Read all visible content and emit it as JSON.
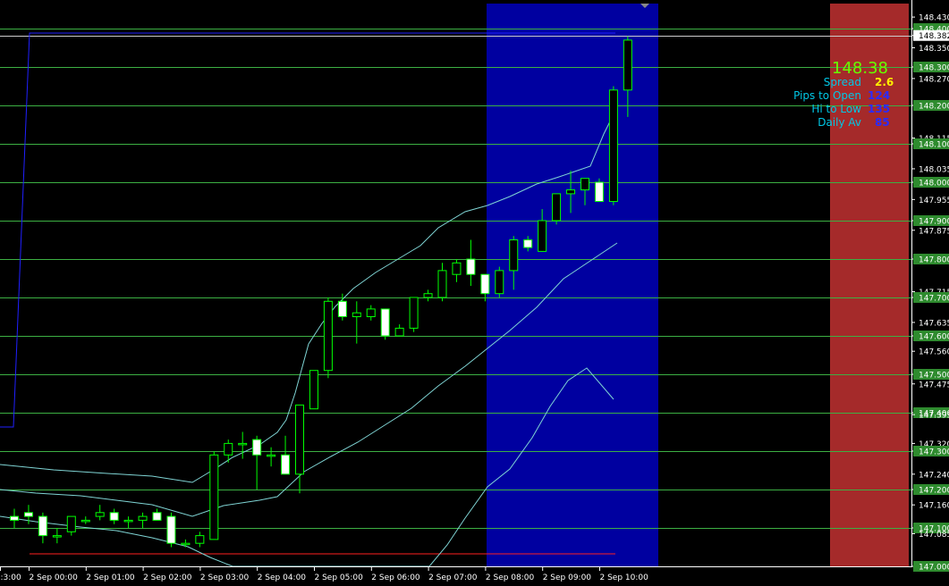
{
  "colors": {
    "background": "#000000",
    "bull_candle": "#000000",
    "bear_candle": "#ffffff",
    "candle_outline": "#00ff00",
    "grid_line": "#3cb043",
    "price_label_bg": "#2e8b2e",
    "current_price_label_bg": "#ffffff",
    "session_band": "#0000a0",
    "right_zone": "#a52a2a",
    "band_line": "#7fd4d4",
    "blue_line": "#2020ff",
    "red_line": "#ff2020",
    "info_green": "#66ff00",
    "info_cyan": "#00c8e6",
    "info_yellow": "#ffee00",
    "info_blue": "#2a2aff"
  },
  "info": {
    "price": "148.38",
    "rows": [
      {
        "label": "Spread",
        "value": "2.6",
        "color": "#ffee00"
      },
      {
        "label": "Pips to Open",
        "value": "124",
        "color": "#2a2aff"
      },
      {
        "label": "Hi to Low",
        "value": "135",
        "color": "#2a2aff"
      },
      {
        "label": "Daily Av",
        "value": "85",
        "color": "#2a2aff"
      }
    ]
  },
  "chart_data": {
    "type": "candlestick",
    "y_axis_labels": [
      "148.430",
      "148.400",
      "148.382",
      "148.350",
      "148.300",
      "148.270",
      "148.200",
      "148.115",
      "148.100",
      "148.035",
      "148.000",
      "147.955",
      "147.900",
      "147.875",
      "147.800",
      "147.715",
      "147.700",
      "147.635",
      "147.600",
      "147.560",
      "147.500",
      "147.475",
      "147.400",
      "147.395",
      "147.320",
      "147.300",
      "147.240",
      "147.200",
      "147.160",
      "147.100",
      "147.085",
      "147.000"
    ],
    "level_lines": [
      148.4,
      148.3,
      148.2,
      148.1,
      148.0,
      147.9,
      147.8,
      147.7,
      147.6,
      147.5,
      147.4,
      147.3,
      147.2,
      147.1,
      147.0
    ],
    "current_price": 148.382,
    "x_axis_labels": [
      ":3:00",
      "2 Sep 00:00",
      "2 Sep 01:00",
      "2 Sep 02:00",
      "2 Sep 03:00",
      "2 Sep 04:00",
      "2 Sep 05:00",
      "2 Sep 06:00",
      "2 Sep 07:00",
      "2 Sep 08:00",
      "2 Sep 09:00",
      "2 Sep 10:00"
    ],
    "candles": [
      {
        "o": 147.13,
        "h": 147.15,
        "l": 147.1,
        "c": 147.12
      },
      {
        "o": 147.14,
        "h": 147.16,
        "l": 147.11,
        "c": 147.13
      },
      {
        "o": 147.13,
        "h": 147.14,
        "l": 147.06,
        "c": 147.08
      },
      {
        "o": 147.08,
        "h": 147.1,
        "l": 147.06,
        "c": 147.08
      },
      {
        "o": 147.09,
        "h": 147.13,
        "l": 147.08,
        "c": 147.13
      },
      {
        "o": 147.12,
        "h": 147.13,
        "l": 147.11,
        "c": 147.12
      },
      {
        "o": 147.13,
        "h": 147.16,
        "l": 147.12,
        "c": 147.14
      },
      {
        "o": 147.14,
        "h": 147.15,
        "l": 147.11,
        "c": 147.12
      },
      {
        "o": 147.12,
        "h": 147.13,
        "l": 147.1,
        "c": 147.12
      },
      {
        "o": 147.12,
        "h": 147.14,
        "l": 147.1,
        "c": 147.13
      },
      {
        "o": 147.14,
        "h": 147.15,
        "l": 147.12,
        "c": 147.12
      },
      {
        "o": 147.13,
        "h": 147.14,
        "l": 147.05,
        "c": 147.06
      },
      {
        "o": 147.06,
        "h": 147.07,
        "l": 147.05,
        "c": 147.06
      },
      {
        "o": 147.06,
        "h": 147.09,
        "l": 147.05,
        "c": 147.08
      },
      {
        "o": 147.07,
        "h": 147.3,
        "l": 147.07,
        "c": 147.29
      },
      {
        "o": 147.29,
        "h": 147.33,
        "l": 147.27,
        "c": 147.32
      },
      {
        "o": 147.32,
        "h": 147.35,
        "l": 147.28,
        "c": 147.32
      },
      {
        "o": 147.33,
        "h": 147.34,
        "l": 147.2,
        "c": 147.29
      },
      {
        "o": 147.29,
        "h": 147.31,
        "l": 147.26,
        "c": 147.29
      },
      {
        "o": 147.29,
        "h": 147.34,
        "l": 147.24,
        "c": 147.24
      },
      {
        "o": 147.24,
        "h": 147.4,
        "l": 147.19,
        "c": 147.42
      },
      {
        "o": 147.41,
        "h": 147.51,
        "l": 147.41,
        "c": 147.51
      },
      {
        "o": 147.51,
        "h": 147.7,
        "l": 147.49,
        "c": 147.69
      },
      {
        "o": 147.69,
        "h": 147.71,
        "l": 147.64,
        "c": 147.65
      },
      {
        "o": 147.65,
        "h": 147.69,
        "l": 147.58,
        "c": 147.66
      },
      {
        "o": 147.65,
        "h": 147.68,
        "l": 147.64,
        "c": 147.67
      },
      {
        "o": 147.67,
        "h": 147.67,
        "l": 147.59,
        "c": 147.6
      },
      {
        "o": 147.6,
        "h": 147.63,
        "l": 147.6,
        "c": 147.62
      },
      {
        "o": 147.62,
        "h": 147.7,
        "l": 147.61,
        "c": 147.7
      },
      {
        "o": 147.7,
        "h": 147.72,
        "l": 147.69,
        "c": 147.71
      },
      {
        "o": 147.7,
        "h": 147.79,
        "l": 147.69,
        "c": 147.77
      },
      {
        "o": 147.76,
        "h": 147.8,
        "l": 147.74,
        "c": 147.79
      },
      {
        "o": 147.8,
        "h": 147.85,
        "l": 147.73,
        "c": 147.76
      },
      {
        "o": 147.76,
        "h": 147.76,
        "l": 147.69,
        "c": 147.71
      },
      {
        "o": 147.71,
        "h": 147.78,
        "l": 147.7,
        "c": 147.77
      },
      {
        "o": 147.77,
        "h": 147.86,
        "l": 147.72,
        "c": 147.85
      },
      {
        "o": 147.85,
        "h": 147.86,
        "l": 147.82,
        "c": 147.83
      },
      {
        "o": 147.82,
        "h": 147.93,
        "l": 147.82,
        "c": 147.9
      },
      {
        "o": 147.9,
        "h": 147.96,
        "l": 147.89,
        "c": 147.97
      },
      {
        "o": 147.97,
        "h": 148.03,
        "l": 147.92,
        "c": 147.98
      },
      {
        "o": 147.98,
        "h": 148.0,
        "l": 147.94,
        "c": 148.01
      },
      {
        "o": 148.0,
        "h": 148.01,
        "l": 147.95,
        "c": 147.95
      },
      {
        "o": 147.95,
        "h": 148.25,
        "l": 147.94,
        "c": 148.24
      },
      {
        "o": 148.24,
        "h": 148.38,
        "l": 148.17,
        "c": 148.37
      }
    ]
  }
}
